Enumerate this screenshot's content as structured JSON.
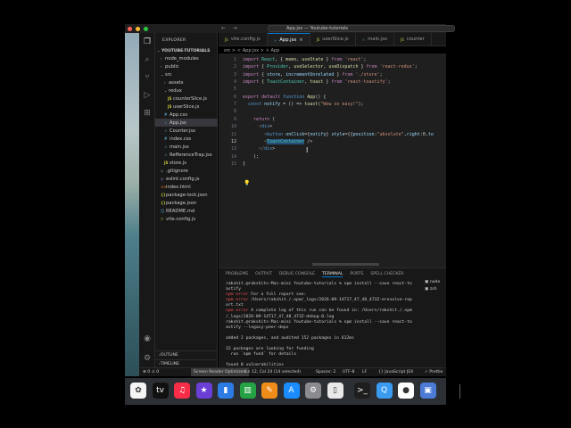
{
  "window": {
    "title": "App.jsx — Youtube-tutorials",
    "nav_arrows": "← →"
  },
  "activity_bar": {
    "icons": [
      "files-icon",
      "search-icon",
      "source-control-icon",
      "run-debug-icon",
      "extensions-icon",
      "account-icon",
      "settings-icon"
    ]
  },
  "explorer": {
    "title": "EXPLORER",
    "root": "YOUTUBE-TUTORIALS",
    "items": [
      {
        "label": "node_modules",
        "type": "folder",
        "indent": 1
      },
      {
        "label": "public",
        "type": "folder",
        "indent": 1
      },
      {
        "label": "src",
        "type": "folder-open",
        "indent": 1
      },
      {
        "label": "assets",
        "type": "folder",
        "indent": 2
      },
      {
        "label": "redux",
        "type": "folder-open",
        "indent": 2
      },
      {
        "label": "counterSlice.js",
        "type": "js",
        "indent": 3
      },
      {
        "label": "userSlice.js",
        "type": "js",
        "indent": 3
      },
      {
        "label": "App.css",
        "type": "css",
        "indent": 2
      },
      {
        "label": "App.jsx",
        "type": "jsx",
        "indent": 2,
        "selected": true
      },
      {
        "label": "Counter.jsx",
        "type": "jsx",
        "indent": 2
      },
      {
        "label": "index.css",
        "type": "css",
        "indent": 2
      },
      {
        "label": "main.jsx",
        "type": "jsx",
        "indent": 2
      },
      {
        "label": "RefferenceTrap.jsx",
        "type": "jsx",
        "indent": 2
      },
      {
        "label": "store.js",
        "type": "js",
        "indent": 2
      },
      {
        "label": ".gitignore",
        "type": "git",
        "indent": 1
      },
      {
        "label": "eslint.config.js",
        "type": "eslint",
        "indent": 1
      },
      {
        "label": "index.html",
        "type": "html",
        "indent": 1
      },
      {
        "label": "package-lock.json",
        "type": "json",
        "indent": 1
      },
      {
        "label": "package.json",
        "type": "json",
        "indent": 1
      },
      {
        "label": "README.md",
        "type": "md",
        "indent": 1
      },
      {
        "label": "vite.config.js",
        "type": "es",
        "indent": 1
      }
    ],
    "outline": "OUTLINE",
    "timeline": "TIMELINE"
  },
  "tabs": [
    {
      "label": "vite.config.js",
      "icon": "JS",
      "active": false
    },
    {
      "label": "App.jsx",
      "icon": "⚛",
      "active": true
    },
    {
      "label": "userSlice.js",
      "icon": "JS",
      "active": false
    },
    {
      "label": "main.jsx",
      "icon": "⚛",
      "active": false
    },
    {
      "label": "counter",
      "icon": "JS",
      "active": false
    }
  ],
  "breadcrumb": "src > ⚛ App.jsx > ⚛ App",
  "editor": {
    "line_numbers": [
      "1",
      "2",
      "3",
      "4",
      "5",
      "6",
      "7",
      "8",
      "9",
      "10",
      "11",
      "12",
      "13",
      "14",
      "15"
    ],
    "current_line": "12",
    "code_lines": [
      "import React, { memo, useState } from 'react';",
      "import { Provider, useSelector, useDispatch } from 'react-redux';",
      "import { store, incrementUnrelated } from './store';",
      "import { ToastContainer, toast } from 'react-toastify';",
      "",
      "export default function App() {",
      "  const notify = () => toast(\"Wow so easy!\");",
      "",
      "    return (",
      "      <div>",
      "        <button onClick={notify} style={{position:\"absolute\",right:0,to",
      "        <ToastContainer />",
      "      </div>",
      "    );",
      "}"
    ]
  },
  "panel": {
    "tabs": [
      "PROBLEMS",
      "OUTPUT",
      "DEBUG CONSOLE",
      "TERMINAL",
      "PORTS",
      "SPELL CHECKER"
    ],
    "active_tab": "TERMINAL",
    "terminal_lines": [
      "rakshit.@rakshits-Mac-mini Youtube-tutorials % npm install --save react-to",
      "astify",
      "npm error For a full report see:",
      "npm error /Users/rakshit./.npm/_logs/2026-09-14T17_47_48_473Z-eresolve-rep",
      "ort.txt",
      "npm error A complete log of this run can be found in: /Users/rakshit./.npm",
      "/_logs/2026-09-14T17_47_48_473Z-debug-0.log",
      "rakshit.@rakshits-Mac-mini Youtube-tutorials % npm install --save react-to",
      "astify --legacy-peer-deps",
      "",
      "added 2 packages, and audited 152 packages in 612ms",
      "",
      "32 packages are looking for funding",
      "  run `npm fund` for details",
      "",
      "found 0 vulnerabilities",
      "rakshit.@rakshits-Mac-mini Youtube-tutorials % []"
    ],
    "side_items": [
      "node",
      "zsh"
    ]
  },
  "status_bar": {
    "screen_reader": "Screen Reader Optimized",
    "position": "Ln 12, Col 24 (14 selected)",
    "spaces": "Spaces: 2",
    "encoding": "UTF-8",
    "eol": "LF",
    "language": "{} JavaScript JSX",
    "prettier": "✓ Prettie"
  },
  "dock": {
    "apps": [
      {
        "name": "photos-icon",
        "glyph": "✿",
        "color": "#f5f5f5"
      },
      {
        "name": "appletv-icon",
        "glyph": "tv",
        "color": "#111111"
      },
      {
        "name": "music-icon",
        "glyph": "♫",
        "color": "#fa2d48"
      },
      {
        "name": "imovie-icon",
        "glyph": "★",
        "color": "#6b3fd6"
      },
      {
        "name": "keynote-icon",
        "glyph": "▮",
        "color": "#2d7be5"
      },
      {
        "name": "numbers-icon",
        "glyph": "▥",
        "color": "#25a244"
      },
      {
        "name": "pages-icon",
        "glyph": "✎",
        "color": "#f08c1a"
      },
      {
        "name": "appstore-icon",
        "glyph": "A",
        "color": "#1a8cff"
      },
      {
        "name": "system-settings-icon",
        "glyph": "⚙",
        "color": "#8a8a8f"
      },
      {
        "name": "phone-mirroring-icon",
        "glyph": "▯",
        "color": "#e9e9ea"
      },
      {
        "name": "terminal-icon",
        "glyph": ">_",
        "color": "#1e1e1e"
      },
      {
        "name": "quicktime-icon",
        "glyph": "Q",
        "color": "#3a9bf0"
      },
      {
        "name": "chrome-icon",
        "glyph": "●",
        "color": "#ffffff"
      },
      {
        "name": "simulator-icon",
        "glyph": "▣",
        "color": "#4b7bd6"
      }
    ]
  }
}
